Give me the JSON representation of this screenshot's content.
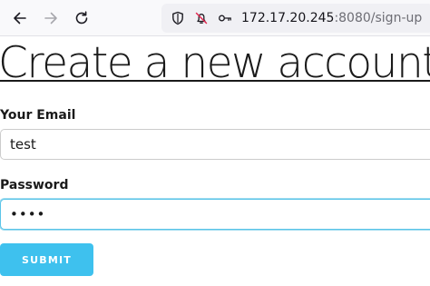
{
  "browser": {
    "url_host": "172.17.20.245",
    "url_rest": ":8080/sign-up",
    "icons": {
      "back": "back-arrow-icon",
      "forward": "forward-arrow-icon",
      "reload": "reload-icon",
      "tracking": "shield-icon",
      "permissions": "blocked-notification-icon",
      "key": "key-icon"
    }
  },
  "page": {
    "title": "Create a new account"
  },
  "form": {
    "email": {
      "label": "Your Email",
      "value": "test"
    },
    "password": {
      "label": "Password",
      "value": "••••"
    },
    "submit_label": "SUBMIT"
  },
  "colors": {
    "accent": "#3ec1ee",
    "focus_border": "#5ac4e8"
  }
}
